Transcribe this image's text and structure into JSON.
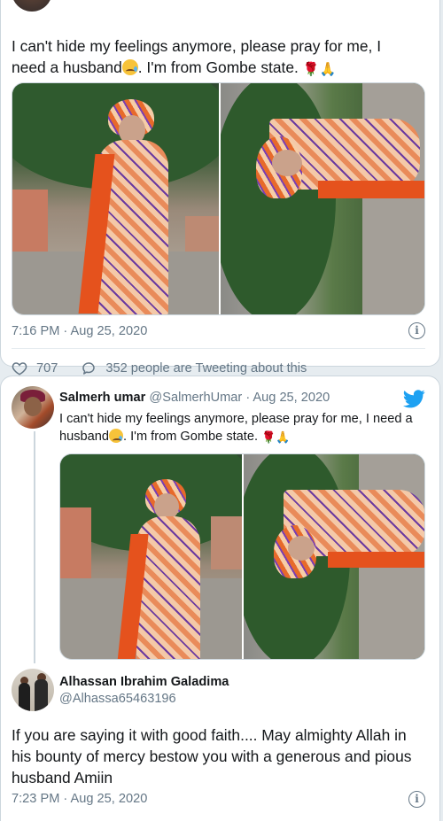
{
  "top_tweet": {
    "text_line1": "I can't hide my feelings anymore, please pray for me, I",
    "text_line2_before": "need a husband",
    "text_line2_after": ". I'm from Gombe state.",
    "timestamp": "7:16 PM · Aug 25, 2020",
    "likes": "707",
    "retweet_text": "352 people are Tweeting about this"
  },
  "quoted_tweet": {
    "name": "Salmerh umar",
    "handle": "@SalmerhUmar",
    "date": "· Aug 25, 2020",
    "text_line1": "I can't hide my feelings anymore, please pray for me, I need a",
    "text_line2_before": "husband",
    "text_line2_after": ". I'm from Gombe state."
  },
  "reply": {
    "name": "Alhassan Ibrahim Galadima",
    "handle": "@Alhassa65463196",
    "text": "If you are saying it with good faith.... May almighty Allah in his bounty of mercy bestow you with a generous and pious husband Amiin",
    "timestamp": "7:23 PM · Aug 25, 2020"
  },
  "icons": {
    "info": "info-icon",
    "heart": "heart-icon",
    "bubble": "speech-bubble-icon",
    "bird": "twitter-bird-icon",
    "info_glyph": "i"
  },
  "colors": {
    "twitter_blue": "#1da1f2",
    "secondary_text": "#657786",
    "border": "#ccd6dd"
  }
}
